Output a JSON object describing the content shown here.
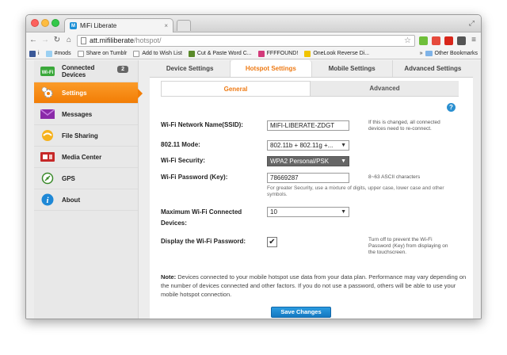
{
  "browser": {
    "tab_title": "MiFi Liberate",
    "tab_close": "×",
    "url_host": "att.mifiliberate",
    "url_path": "/hotspot/",
    "bookmarks": [
      {
        "label": "i",
        "color": "#3b5998"
      },
      {
        "label": "#mods",
        "color": "#9bd0f2"
      },
      {
        "label": "Share on Tumblr",
        "color": "#ffffff"
      },
      {
        "label": "Add to Wish List",
        "color": "#ffffff"
      },
      {
        "label": "Cut & Paste Word C...",
        "color": "#5a8a2a"
      },
      {
        "label": "FFFFOUND!",
        "color": "#d33a7a"
      },
      {
        "label": "OneLook Reverse Di...",
        "color": "#f0c400"
      }
    ],
    "other_bookmarks": "Other Bookmarks",
    "chevron": "»"
  },
  "sidebar": {
    "items": [
      {
        "label": "Connected Devices",
        "badge": "2",
        "icon": "wifi-icon"
      },
      {
        "label": "Settings",
        "icon": "gears-icon"
      },
      {
        "label": "Messages",
        "icon": "envelope-icon"
      },
      {
        "label": "File Sharing",
        "icon": "file-sharing-icon"
      },
      {
        "label": "Media Center",
        "icon": "media-center-icon"
      },
      {
        "label": "GPS",
        "icon": "gps-icon"
      },
      {
        "label": "About",
        "icon": "info-icon"
      }
    ],
    "active_color": "#f27d05"
  },
  "tabs": [
    "Device Settings",
    "Hotspot Settings",
    "Mobile Settings",
    "Advanced Settings"
  ],
  "subtabs": [
    "General",
    "Advanced"
  ],
  "form": {
    "ssid_label": "Wi-Fi Network Name(SSID):",
    "ssid_value": "MIFI-LIBERATE-ZDGT",
    "ssid_hint": "If this is changed, all connected devices need to re-connect.",
    "mode_label": "802.11 Mode:",
    "mode_value": "802.11b + 802.11g +...",
    "security_label": "Wi-Fi Security:",
    "security_value": "WPA2 Personal/PSK",
    "password_label": "Wi-Fi Password (Key):",
    "password_value": "78669287",
    "password_hint": "8~63 ASCII characters",
    "password_subhint": "For greater Security, use a mixture of digits, upper case, lower case and other symbols.",
    "max_label": "Maximum Wi-Fi Connected Devices:",
    "max_value": "10",
    "display_label": "Display the Wi-Fi Password:",
    "display_hint": "Turn off to prevent the Wi-Fi Password (Key) from displaying on the touchscreen.",
    "display_checked": "✔"
  },
  "note": {
    "prefix": "Note:",
    "text": " Devices connected to your mobile hotspot use data from your data plan. Performance may vary depending on the number of devices connected and other factors. If you do not use a password, others will be able to use your mobile hotspot connection."
  },
  "save_label": "Save Changes",
  "help": "?"
}
